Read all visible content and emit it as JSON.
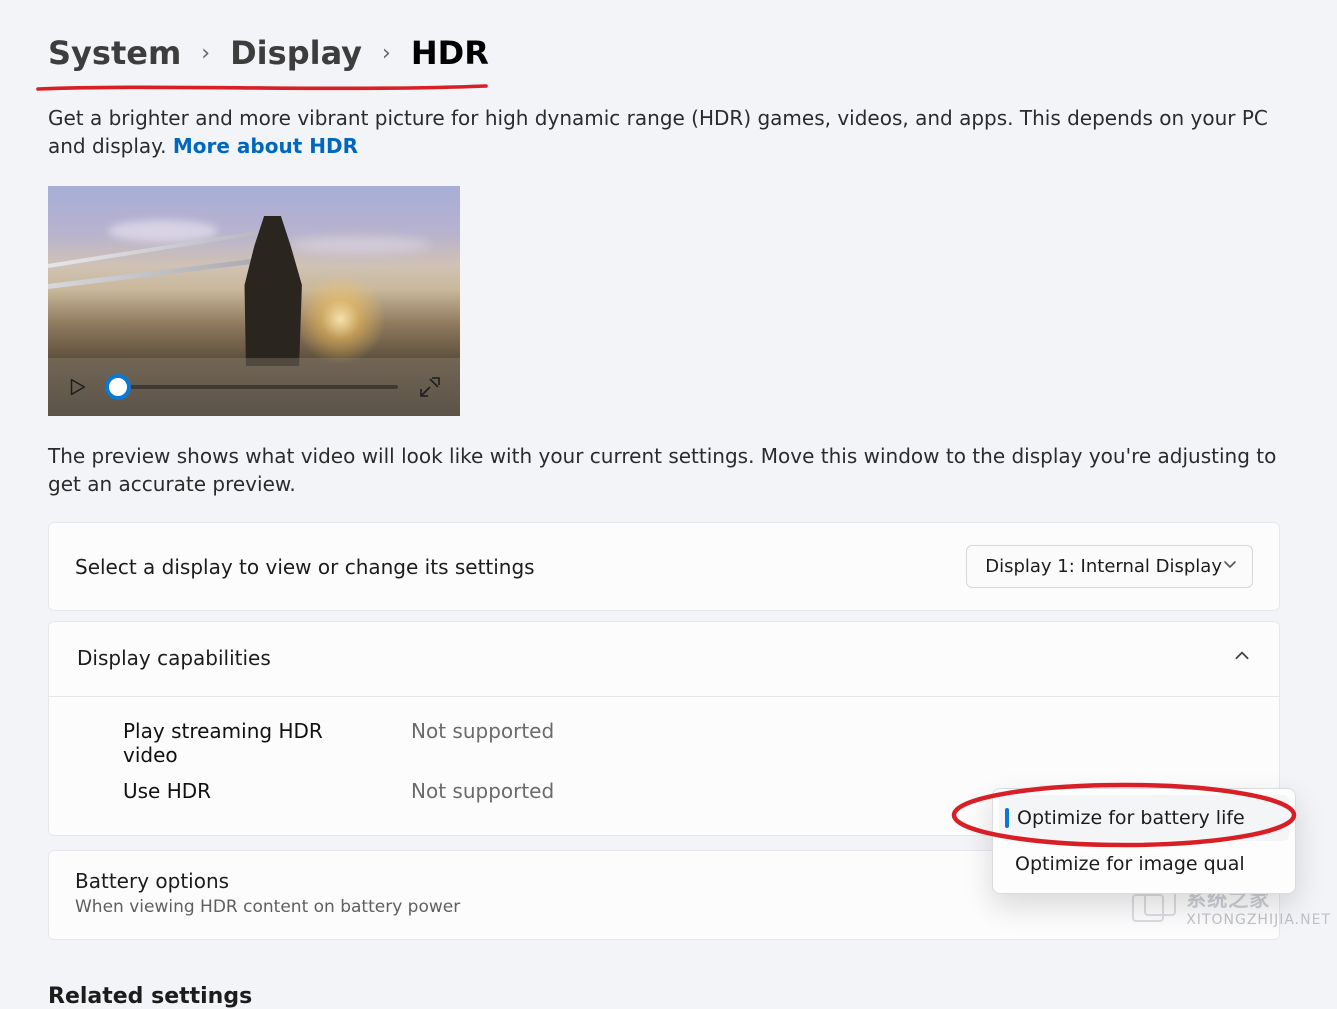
{
  "breadcrumb": {
    "lvl1": "System",
    "lvl2": "Display",
    "current": "HDR"
  },
  "description": {
    "text": "Get a brighter and more vibrant picture for high dynamic range (HDR) games, videos, and apps. This depends on your PC and display. ",
    "link": "More about HDR"
  },
  "preview_note": "The preview shows what video will look like with your current settings. Move this window to the display you're adjusting to get an accurate preview.",
  "display_selector": {
    "label": "Select a display to view or change its settings",
    "value": "Display 1: Internal Display"
  },
  "capabilities": {
    "title": "Display capabilities",
    "rows": [
      {
        "label": "Play streaming HDR video",
        "value": "Not supported"
      },
      {
        "label": "Use HDR",
        "value": "Not supported"
      }
    ]
  },
  "battery": {
    "title": "Battery options",
    "subtitle": "When viewing HDR content on battery power",
    "options": [
      "Optimize for battery life",
      "Optimize for image qual"
    ],
    "selected_index": 0
  },
  "related_heading": "Related settings",
  "watermark": {
    "cn": "系统之家",
    "url": "XITONGZHIJIA.NET"
  },
  "icons": {
    "chevron_right": "›",
    "chevron_down": "⌄",
    "chevron_up": "⌃"
  }
}
